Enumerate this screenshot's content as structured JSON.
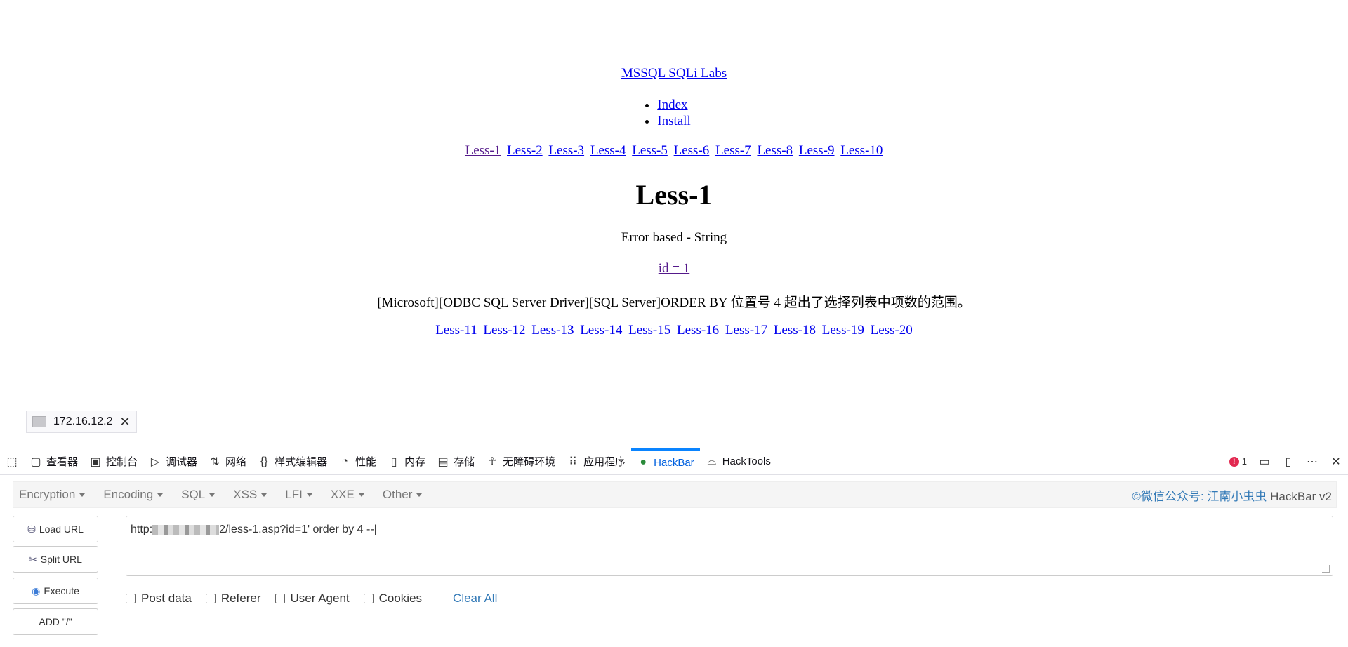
{
  "site_title": "MSSQL SQLi Labs",
  "nav": [
    "Index",
    "Install"
  ],
  "lessons_top": [
    "Less-1",
    "Less-2",
    "Less-3",
    "Less-4",
    "Less-5",
    "Less-6",
    "Less-7",
    "Less-8",
    "Less-9",
    "Less-10"
  ],
  "lesson": {
    "title": "Less-1",
    "subtitle": "Error based - String",
    "id_link": "id = 1",
    "error": "[Microsoft][ODBC SQL Server Driver][SQL Server]ORDER BY 位置号 4 超出了选择列表中项数的范围。"
  },
  "lessons_bottom": [
    "Less-11",
    "Less-12",
    "Less-13",
    "Less-14",
    "Less-15",
    "Less-16",
    "Less-17",
    "Less-18",
    "Less-19",
    "Less-20"
  ],
  "status_tip": {
    "host": "172.16.12.2"
  },
  "devtools": {
    "tabs": [
      {
        "label": "查看器",
        "icon": "inspector-icon"
      },
      {
        "label": "控制台",
        "icon": "console-icon"
      },
      {
        "label": "调试器",
        "icon": "debugger-icon"
      },
      {
        "label": "网络",
        "icon": "network-icon"
      },
      {
        "label": "样式编辑器",
        "icon": "style-editor-icon"
      },
      {
        "label": "性能",
        "icon": "performance-icon"
      },
      {
        "label": "内存",
        "icon": "memory-icon"
      },
      {
        "label": "存储",
        "icon": "storage-icon"
      },
      {
        "label": "无障碍环境",
        "icon": "accessibility-icon"
      },
      {
        "label": "应用程序",
        "icon": "application-icon"
      },
      {
        "label": "HackBar",
        "icon": "hackbar-icon"
      },
      {
        "label": "HackTools",
        "icon": "hacktools-icon"
      }
    ],
    "active_tab": "HackBar",
    "error_count": "1"
  },
  "hackbar": {
    "menu": [
      "Encryption",
      "Encoding",
      "SQL",
      "XSS",
      "LFI",
      "XXE",
      "Other"
    ],
    "brand_prefix": "©微信公众号: 江南小虫虫",
    "brand_suffix": " HackBar v2",
    "buttons": {
      "load": "Load URL",
      "split": "Split URL",
      "execute": "Execute",
      "add": "ADD \"/\""
    },
    "url_prefix": "http:",
    "url_suffix": "2/less-1.asp?id=1' order by 4 --",
    "checkboxes": [
      "Post data",
      "Referer",
      "User Agent",
      "Cookies"
    ],
    "clear_all": "Clear All"
  }
}
